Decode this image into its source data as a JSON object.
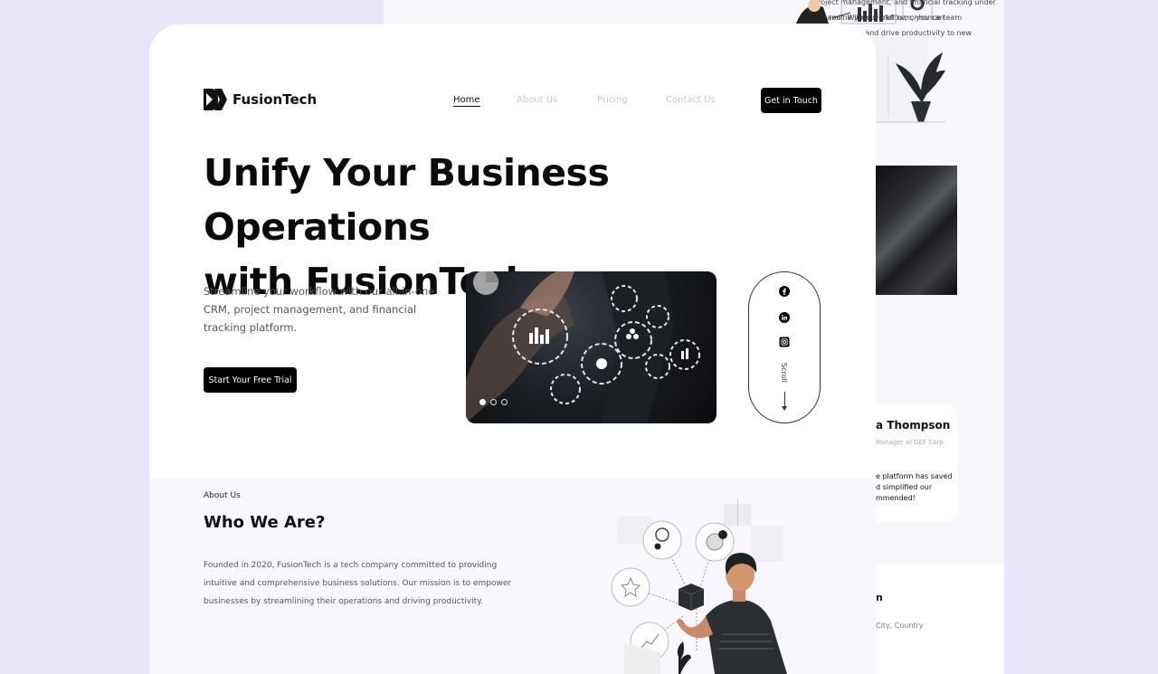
{
  "background_page": {
    "intro_lines": [
      "project management, and financial tracking under one roof. With our platform, you can",
      "streamline your workflow, enhance team collaboration, and drive productivity to new"
    ],
    "testimonial": {
      "name": "a Thompson",
      "role": "Manager at DEF Corp",
      "quote": "e platform has saved\nd simplified our\nmmended!"
    },
    "footer": {
      "title": "n",
      "address": "City, Country"
    }
  },
  "header": {
    "brand": "FusionTech",
    "nav": [
      "Home",
      "About Us",
      "Pricing",
      "Contact Us"
    ],
    "cta": "Get in Touch"
  },
  "hero": {
    "title_line1": "Unify Your Business Operations",
    "title_line2": "with FusionTech",
    "lead": "Streamline your workflow with our all-in-one CRM, project management, and financial tracking platform.",
    "button": "Start Your Free Trial",
    "carousel": {
      "slides": 3,
      "active": 1
    },
    "social": {
      "icons": [
        "facebook-icon",
        "linkedin-icon",
        "instagram-icon"
      ],
      "scroll_label": "Scroll"
    }
  },
  "about": {
    "eyebrow": "About Us",
    "title": "Who We Are?",
    "body": "Founded in 2020, FusionTech is a tech company committed to providing intuitive and comprehensive business solutions. Our mission is to empower businesses by streamlining their operations and driving productivity."
  },
  "colors": {
    "background": "#e9e6fb",
    "primary": "#000000",
    "section_tint": "#f8f7fe"
  }
}
